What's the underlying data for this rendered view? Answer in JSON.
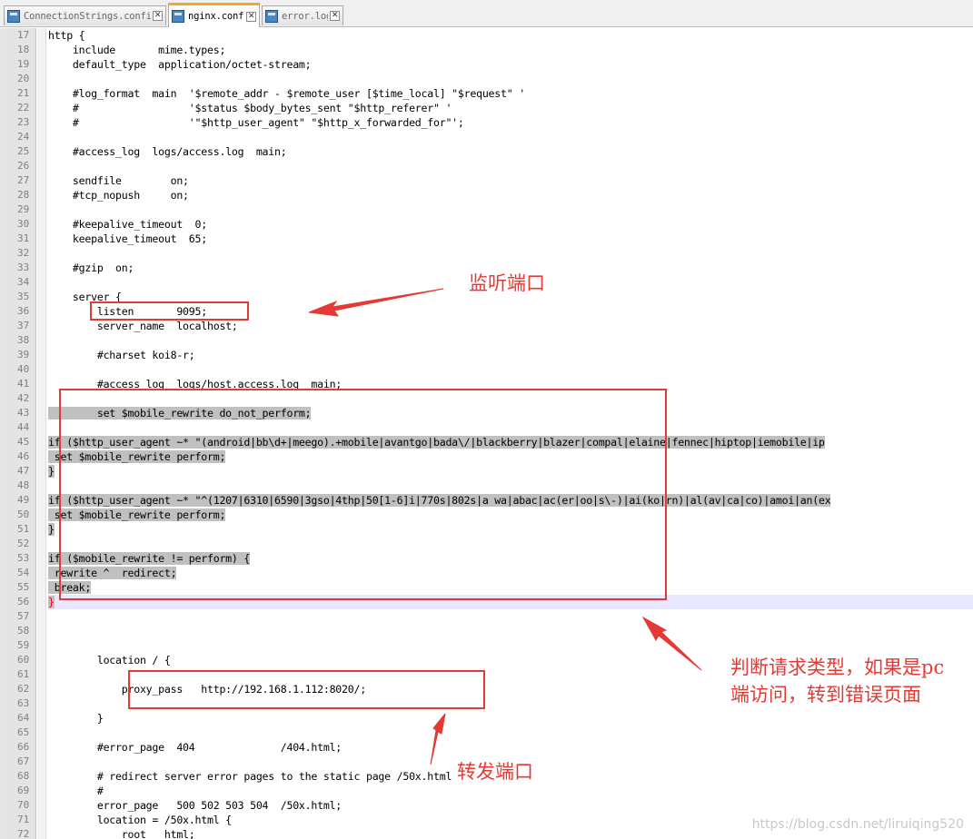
{
  "tabs": [
    {
      "label": "ConnectionStrings.config",
      "active": false
    },
    {
      "label": "nginx.conf",
      "active": true
    },
    {
      "label": "error.log",
      "active": false
    }
  ],
  "editor": {
    "lines": [
      {
        "n": "17",
        "text": "http {"
      },
      {
        "n": "18",
        "text": "    include       mime.types;"
      },
      {
        "n": "19",
        "text": "    default_type  application/octet-stream;"
      },
      {
        "n": "20",
        "text": ""
      },
      {
        "n": "21",
        "text": "    #log_format  main  '$remote_addr - $remote_user [$time_local] \"$request\" '"
      },
      {
        "n": "22",
        "text": "    #                  '$status $body_bytes_sent \"$http_referer\" '"
      },
      {
        "n": "23",
        "text": "    #                  '\"$http_user_agent\" \"$http_x_forwarded_for\"';"
      },
      {
        "n": "24",
        "text": ""
      },
      {
        "n": "25",
        "text": "    #access_log  logs/access.log  main;"
      },
      {
        "n": "26",
        "text": ""
      },
      {
        "n": "27",
        "text": "    sendfile        on;"
      },
      {
        "n": "28",
        "text": "    #tcp_nopush     on;"
      },
      {
        "n": "29",
        "text": ""
      },
      {
        "n": "30",
        "text": "    #keepalive_timeout  0;"
      },
      {
        "n": "31",
        "text": "    keepalive_timeout  65;"
      },
      {
        "n": "32",
        "text": ""
      },
      {
        "n": "33",
        "text": "    #gzip  on;"
      },
      {
        "n": "34",
        "text": ""
      },
      {
        "n": "35",
        "text": "    server {"
      },
      {
        "n": "36",
        "text": "        listen       9095;"
      },
      {
        "n": "37",
        "text": "        server_name  localhost;"
      },
      {
        "n": "38",
        "text": ""
      },
      {
        "n": "39",
        "text": "        #charset koi8-r;"
      },
      {
        "n": "40",
        "text": ""
      },
      {
        "n": "41",
        "text": "        #access_log  logs/host.access.log  main;"
      },
      {
        "n": "42",
        "text": ""
      },
      {
        "n": "43",
        "text": "        set $mobile_rewrite do_not_perform;"
      },
      {
        "n": "44",
        "text": ""
      },
      {
        "n": "45",
        "text": "if ($http_user_agent ~* \"(android|bb\\d+|meego).+mobile|avantgo|bada\\/|blackberry|blazer|compal|elaine|fennec|hiptop|iemobile|ip"
      },
      {
        "n": "46",
        "text": " set $mobile_rewrite perform;"
      },
      {
        "n": "47",
        "text": "}"
      },
      {
        "n": "48",
        "text": ""
      },
      {
        "n": "49",
        "text": "if ($http_user_agent ~* \"^(1207|6310|6590|3gso|4thp|50[1-6]i|770s|802s|a wa|abac|ac(er|oo|s\\-)|ai(ko|rn)|al(av|ca|co)|amoi|an(ex"
      },
      {
        "n": "50",
        "text": " set $mobile_rewrite perform;"
      },
      {
        "n": "51",
        "text": "}"
      },
      {
        "n": "52",
        "text": ""
      },
      {
        "n": "53",
        "text": "if ($mobile_rewrite != perform) {"
      },
      {
        "n": "54",
        "text": " rewrite ^  redirect;"
      },
      {
        "n": "55",
        "text": " break;"
      },
      {
        "n": "56",
        "text": "}"
      },
      {
        "n": "57",
        "text": ""
      },
      {
        "n": "58",
        "text": ""
      },
      {
        "n": "59",
        "text": ""
      },
      {
        "n": "60",
        "text": "        location / {"
      },
      {
        "n": "61",
        "text": ""
      },
      {
        "n": "62",
        "text": "            proxy_pass   http://192.168.1.112:8020/;"
      },
      {
        "n": "63",
        "text": ""
      },
      {
        "n": "64",
        "text": "        }"
      },
      {
        "n": "65",
        "text": ""
      },
      {
        "n": "66",
        "text": "        #error_page  404              /404.html;"
      },
      {
        "n": "67",
        "text": ""
      },
      {
        "n": "68",
        "text": "        # redirect server error pages to the static page /50x.html"
      },
      {
        "n": "69",
        "text": "        #"
      },
      {
        "n": "70",
        "text": "        error_page   500 502 503 504  /50x.html;"
      },
      {
        "n": "71",
        "text": "        location = /50x.html {"
      },
      {
        "n": "72",
        "text": "            root   html;"
      }
    ]
  },
  "annotations": {
    "listen_port": "监听端口",
    "judge_line1": "判断请求类型，如果是pc",
    "judge_line2": "端访问，转到错误页面",
    "forward_port": "转发端口"
  },
  "watermark": "https://blog.csdn.net/liruiqing520",
  "colors": {
    "annotation": "#e53935",
    "selection": "#c0c0c0",
    "active_tab_accent": "#f5a623"
  }
}
